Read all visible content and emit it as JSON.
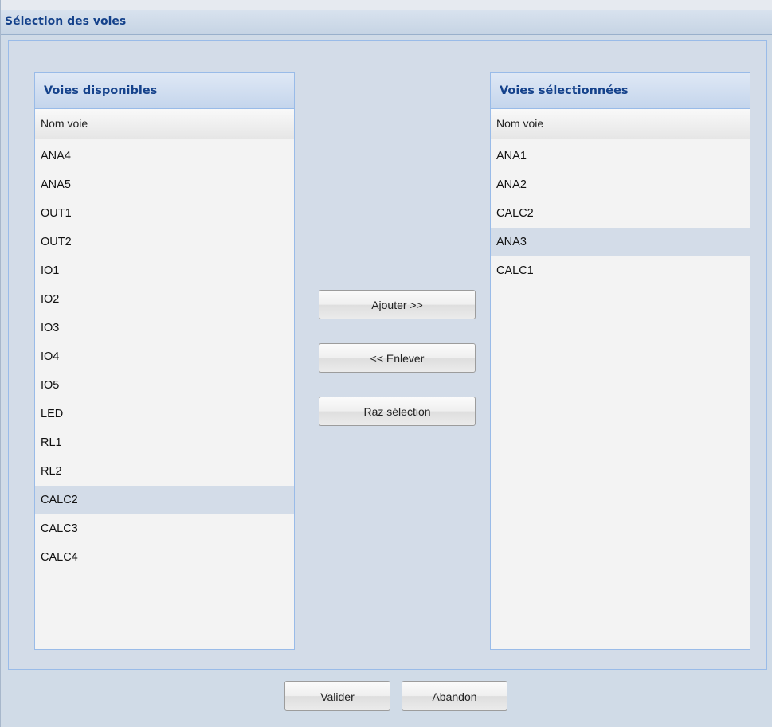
{
  "dialog": {
    "title": "Sélection des voies"
  },
  "available": {
    "title": "Voies disponibles",
    "column_header": "Nom voie",
    "items": [
      "ANA4",
      "ANA5",
      "OUT1",
      "OUT2",
      "IO1",
      "IO2",
      "IO3",
      "IO4",
      "IO5",
      "LED",
      "RL1",
      "RL2",
      "CALC2",
      "CALC3",
      "CALC4"
    ],
    "selected_item": "CALC2"
  },
  "selected": {
    "title": "Voies sélectionnées",
    "column_header": "Nom voie",
    "items": [
      "ANA1",
      "ANA2",
      "CALC2",
      "ANA3",
      "CALC1"
    ],
    "selected_item": "ANA3"
  },
  "actions": {
    "add_label": "Ajouter >>",
    "remove_label": "<< Enlever",
    "reset_label": "Raz sélection"
  },
  "footer": {
    "validate_label": "Valider",
    "cancel_label": "Abandon"
  },
  "colors": {
    "title_text": "#15428b",
    "panel_border": "#99bbe8",
    "selected_row": "#d3dce8"
  }
}
